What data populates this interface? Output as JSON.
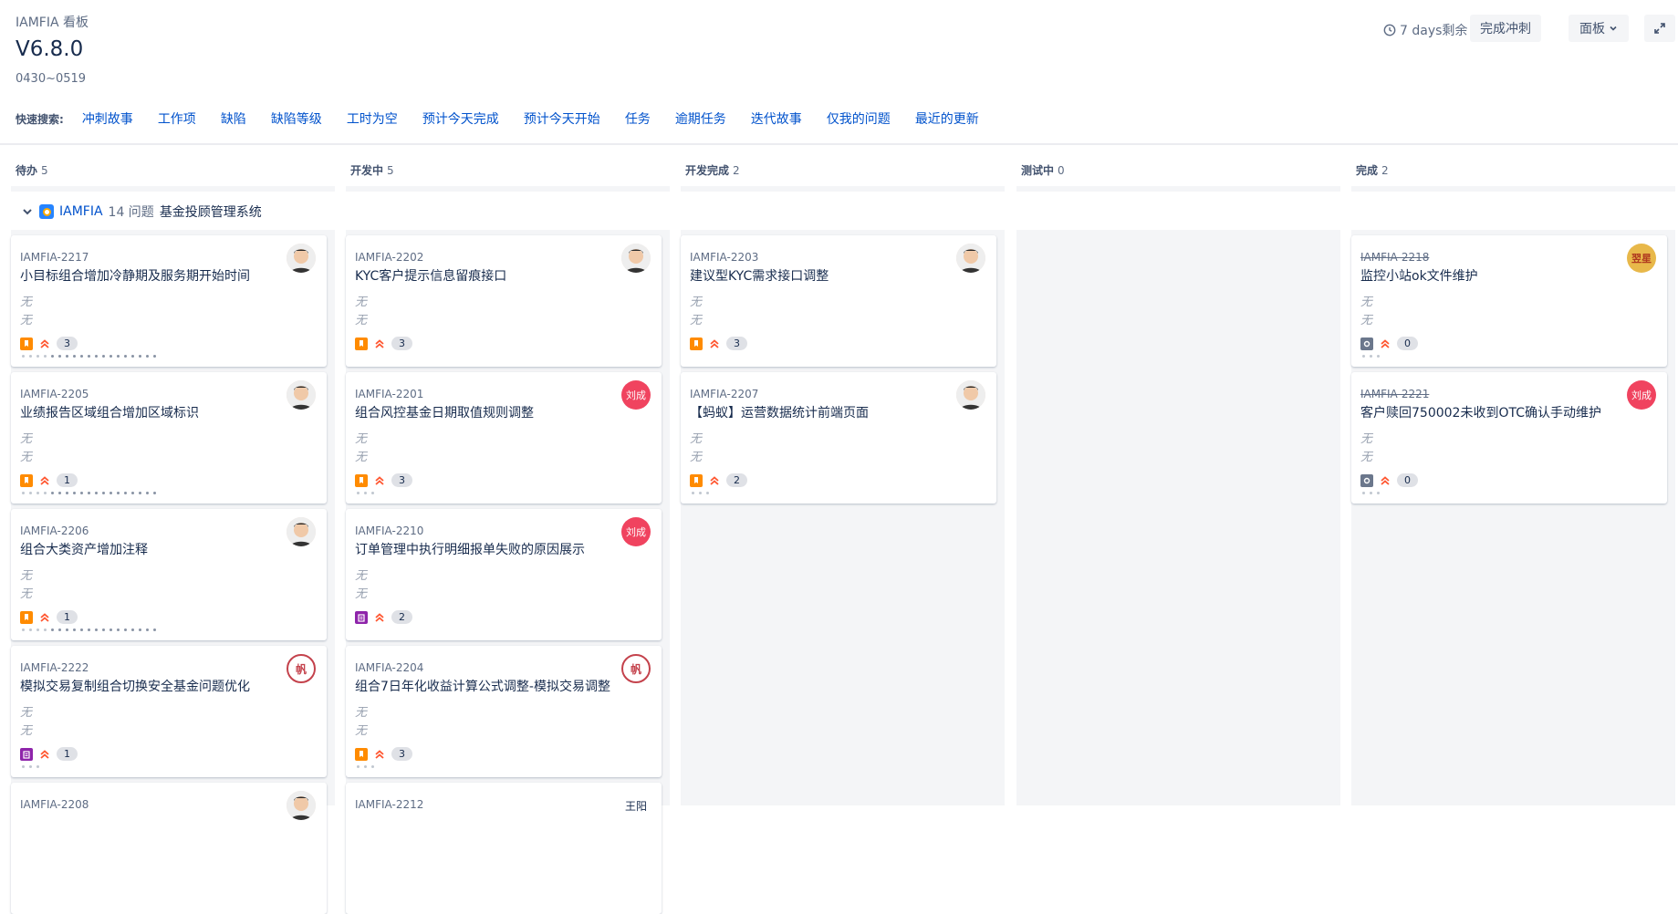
{
  "header": {
    "board_label": "IAMFIA 看板",
    "sprint_name": "V6.8.0",
    "sprint_dates": "0430~0519",
    "remaining": "7 days剩余",
    "complete_sprint": "完成冲刺",
    "board_menu": "面板"
  },
  "quick_filters": {
    "label": "快速搜索:",
    "items": [
      "冲刺故事",
      "工作项",
      "缺陷",
      "缺陷等级",
      "工时为空",
      "预计今天完成",
      "预计今天开始",
      "任务",
      "逾期任务",
      "迭代故事",
      "仅我的问题",
      "最近的更新"
    ]
  },
  "columns": [
    {
      "name": "待办",
      "count": "5"
    },
    {
      "name": "开发中",
      "count": "5"
    },
    {
      "name": "开发完成",
      "count": "2"
    },
    {
      "name": "测试中",
      "count": "0"
    },
    {
      "name": "完成",
      "count": "2"
    }
  ],
  "swimlane": {
    "key": "IAMFIA",
    "count": "14 问题",
    "name": "基金投顾管理系统"
  },
  "cards": [
    {
      "key": "IAMFIA-2217",
      "summary": "小目标组合增加冷静期及服务期开始时间",
      "f1": "无",
      "f2": "无",
      "points": "3",
      "avatar_text": ""
    },
    {
      "key": "IAMFIA-2205",
      "summary": "业绩报告区域组合增加区域标识",
      "f1": "无",
      "f2": "无",
      "points": "1",
      "avatar_text": ""
    },
    {
      "key": "IAMFIA-2206",
      "summary": "组合大类资产增加注释",
      "f1": "无",
      "f2": "无",
      "points": "1",
      "avatar_text": ""
    },
    {
      "key": "IAMFIA-2222",
      "summary": "模拟交易复制组合切换安全基金问题优化",
      "f1": "无",
      "f2": "无",
      "points": "1",
      "avatar_text": "帆"
    },
    {
      "key": "IAMFIA-2208",
      "summary": "",
      "f1": "",
      "f2": "",
      "points": "",
      "avatar_text": ""
    },
    {
      "key": "IAMFIA-2202",
      "summary": "KYC客户提示信息留痕接口",
      "f1": "无",
      "f2": "无",
      "points": "3",
      "avatar_text": ""
    },
    {
      "key": "IAMFIA-2201",
      "summary": "组合风控基金日期取值规则调整",
      "f1": "无",
      "f2": "无",
      "points": "3",
      "avatar_text": "刘成"
    },
    {
      "key": "IAMFIA-2210",
      "summary": "订单管理中执行明细报单失败的原因展示",
      "f1": "无",
      "f2": "无",
      "points": "2",
      "avatar_text": "刘成"
    },
    {
      "key": "IAMFIA-2204",
      "summary": "组合7日年化收益计算公式调整-模拟交易调整",
      "f1": "无",
      "f2": "无",
      "points": "3",
      "avatar_text": "帆"
    },
    {
      "key": "IAMFIA-2212",
      "summary": "",
      "f1": "",
      "f2": "",
      "points": "",
      "avatar_text": "王阳"
    },
    {
      "key": "IAMFIA-2203",
      "summary": "建议型KYC需求接口调整",
      "f1": "无",
      "f2": "无",
      "points": "3",
      "avatar_text": ""
    },
    {
      "key": "IAMFIA-2207",
      "summary": "【蚂蚁】运营数据统计前端页面",
      "f1": "无",
      "f2": "无",
      "points": "2",
      "avatar_text": ""
    },
    {
      "key": "IAMFIA-2218",
      "summary": "监控小站ok文件维护",
      "f1": "无",
      "f2": "无",
      "points": "0",
      "avatar_text": "翌星"
    },
    {
      "key": "IAMFIA-2221",
      "summary": "客户赎回750002未收到OTC确认手动维护",
      "f1": "无",
      "f2": "无",
      "points": "0",
      "avatar_text": "刘成"
    }
  ]
}
